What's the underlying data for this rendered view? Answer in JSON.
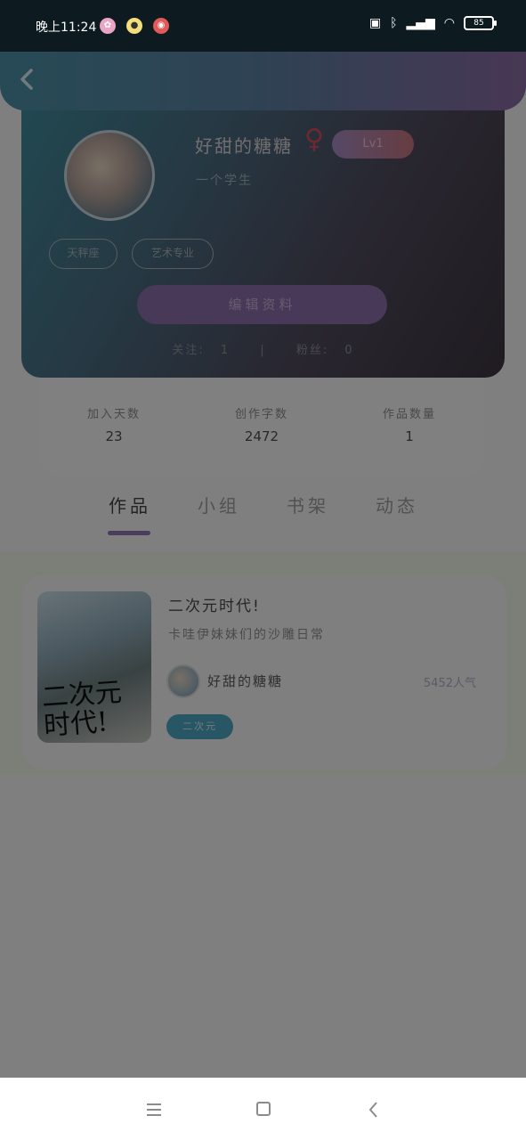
{
  "status_bar": {
    "time": "晚上11:24",
    "app_icons": [
      "flower-app-icon",
      "chick-app-icon",
      "red-app-icon"
    ],
    "battery": "85"
  },
  "header": {
    "back_icon": "chevron-left-icon"
  },
  "profile": {
    "username": "好甜的糖糖",
    "gender_symbol": "♀",
    "level": "Lv1",
    "bio": "一个学生",
    "tags": [
      "天秤座",
      "艺术专业"
    ],
    "edit_button": "编辑资料",
    "following_label": "关注:",
    "following_count": "1",
    "separator": "|",
    "followers_label": "粉丝:",
    "followers_count": "0"
  },
  "stats": [
    {
      "label": "加入天数",
      "value": "23"
    },
    {
      "label": "创作字数",
      "value": "2472"
    },
    {
      "label": "作品数量",
      "value": "1"
    }
  ],
  "tabs": [
    "作品",
    "小组",
    "书架",
    "动态"
  ],
  "active_tab": "作品",
  "work": {
    "cover_text": "二次元 时代!",
    "title": "二次元时代!",
    "description": "卡哇伊妹妹们的沙雕日常",
    "author": "好甜的糖糖",
    "popularity": "5452人气",
    "genre_tag": "二次元"
  },
  "colors": {
    "accent_purple": "#8a6ea9",
    "tag_blue": "#4fa6c0",
    "header_start": "#4c8fa5",
    "header_end": "#8a6aa2"
  }
}
